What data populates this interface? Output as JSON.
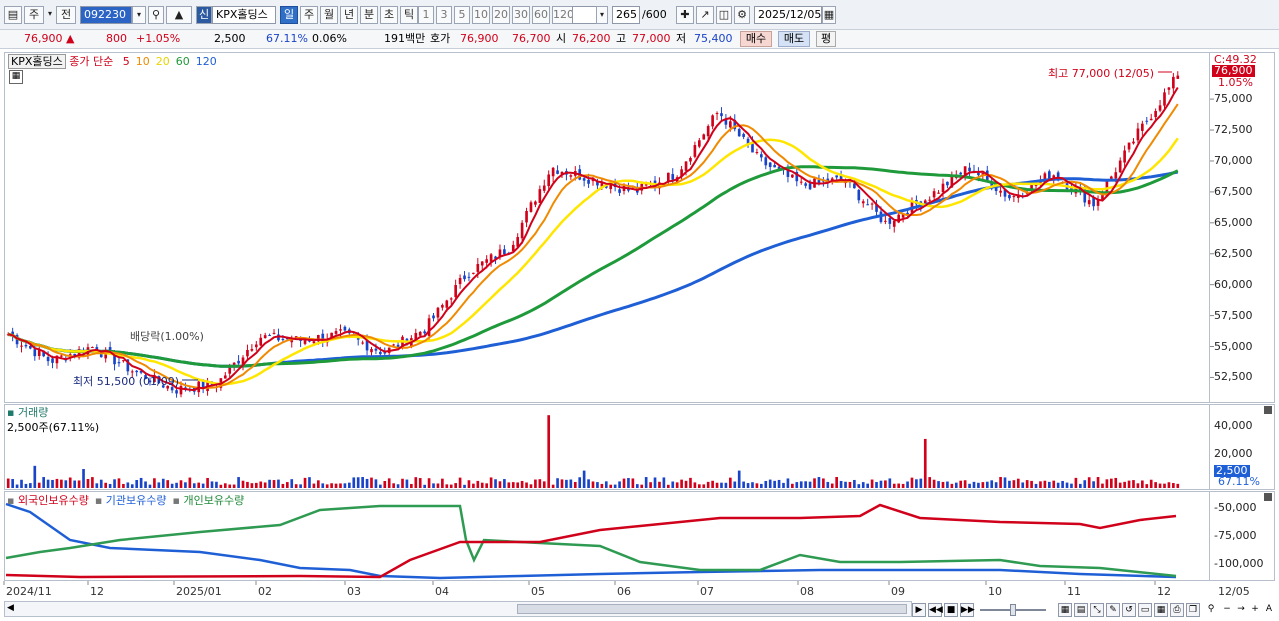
{
  "toolbar": {
    "period_main": "주",
    "prev_label": "전",
    "code": "092230",
    "tag_new": "신",
    "name": "KPX홀딩스",
    "periods": [
      "일",
      "주",
      "월",
      "년",
      "분",
      "초",
      "틱"
    ],
    "active_period": "일",
    "intervals": [
      "1",
      "3",
      "5",
      "10",
      "20",
      "30",
      "60",
      "120"
    ],
    "count": "265",
    "count_total": "/600",
    "date": "2025/12/05"
  },
  "quote": {
    "price": "76,900",
    "change": "800",
    "change_pct": "+1.05%",
    "volume": "2,500",
    "volume_ratio": "67.11%",
    "turnover": "0.06%",
    "amount": "191백만",
    "ask_label": "호가",
    "ask1": "76,900",
    "ask2": "76,700",
    "open_label": "시",
    "open": "76,200",
    "high_label": "고",
    "high": "77,000",
    "low_label": "저",
    "low": "75,400",
    "buy": "매수",
    "sell": "매도",
    "eval": "평"
  },
  "price_panel": {
    "legend_name": "KPX홀딩스",
    "legend_rest": "종가 단순",
    "ma_labels": [
      {
        "label": "5",
        "color": "#d0021b"
      },
      {
        "label": "10",
        "color": "#f08a00"
      },
      {
        "label": "20",
        "color": "#e8d400"
      },
      {
        "label": "60",
        "color": "#1f9a3a"
      },
      {
        "label": "120",
        "color": "#1f5fd6"
      }
    ],
    "axis_header": "C:49.32",
    "current_price_tag": "76,900",
    "current_pct_tag": "1.05%",
    "high_note": "최고 77,000 (12/05)",
    "low_note": "최저 51,500 (01/09)",
    "dividend_note": "배당락(1.00%)",
    "y_ticks": [
      "75,000",
      "72,500",
      "70,000",
      "67,500",
      "65,000",
      "62,500",
      "60,000",
      "57,500",
      "55,000",
      "52,500"
    ]
  },
  "volume_panel": {
    "title": "거래량",
    "value_note": "2,500주(67.11%)",
    "y_ticks": [
      "40,000",
      "20,000"
    ],
    "current_tag": "2,500",
    "current_pct": "67.11%"
  },
  "holders_panel": {
    "legend": [
      {
        "label": "외국인보유수량",
        "color": "#d0021b"
      },
      {
        "label": "기관보유수량",
        "color": "#1f5fd6"
      },
      {
        "label": "개인보유수량",
        "color": "#1f8a3a"
      }
    ],
    "y_ticks": [
      "-50,000",
      "-75,000",
      "-100,000"
    ]
  },
  "x_axis": {
    "labels": [
      "2024/11",
      "12",
      "2025/01",
      "02",
      "03",
      "04",
      "05",
      "06",
      "07",
      "08",
      "09",
      "10",
      "11",
      "12"
    ],
    "end_label": "12/05"
  },
  "colors": {
    "up": "#d0021b",
    "down": "#1a44c8",
    "ma5": "#d0021b",
    "ma10": "#f08a00",
    "ma20": "#ffe600",
    "ma60": "#1f9a3a",
    "ma120": "#1f5fd6"
  },
  "chart_data": {
    "type": "candlestick",
    "x_range": [
      "2024/11",
      "2025/12/05"
    ],
    "ylim": [
      51000,
      78000
    ],
    "anchors": [
      {
        "x": "2024/11",
        "close": 56000
      },
      {
        "x": "2024/11 mid",
        "close": 53800
      },
      {
        "x": "2024/12 start",
        "close": 55000
      },
      {
        "x": "2024/12 end",
        "close": 53000
      },
      {
        "x": "2025/01/09",
        "close": 51500
      },
      {
        "x": "2025/02 start",
        "close": 52000
      },
      {
        "x": "2025/02 end",
        "close": 55800
      },
      {
        "x": "2025/03 mid",
        "close": 55500
      },
      {
        "x": "2025/03 end",
        "close": 56000
      },
      {
        "x": "2025/04 start",
        "close": 54500
      },
      {
        "x": "2025/04 end",
        "close": 56500
      },
      {
        "x": "2025/05 mid",
        "close": 61000
      },
      {
        "x": "2025/05 end",
        "close": 63000
      },
      {
        "x": "2025/06 start",
        "close": 69500
      },
      {
        "x": "2025/06 mid",
        "close": 68500
      },
      {
        "x": "2025/06 end",
        "close": 67500
      },
      {
        "x": "2025/07 start",
        "close": 69000
      },
      {
        "x": "2025/07 mid",
        "close": 74000
      },
      {
        "x": "2025/07 end",
        "close": 70000
      },
      {
        "x": "2025/08 start",
        "close": 68000
      },
      {
        "x": "2025/08 mid",
        "close": 68500
      },
      {
        "x": "2025/08 end",
        "close": 65000
      },
      {
        "x": "2025/09 start",
        "close": 67000
      },
      {
        "x": "2025/09 end",
        "close": 69500
      },
      {
        "x": "2025/10 start",
        "close": 67000
      },
      {
        "x": "2025/10 end",
        "close": 69000
      },
      {
        "x": "2025/11 mid",
        "close": 66500
      },
      {
        "x": "2025/11 end",
        "close": 72000
      },
      {
        "x": "2025/12/05",
        "close": 76900
      }
    ]
  }
}
